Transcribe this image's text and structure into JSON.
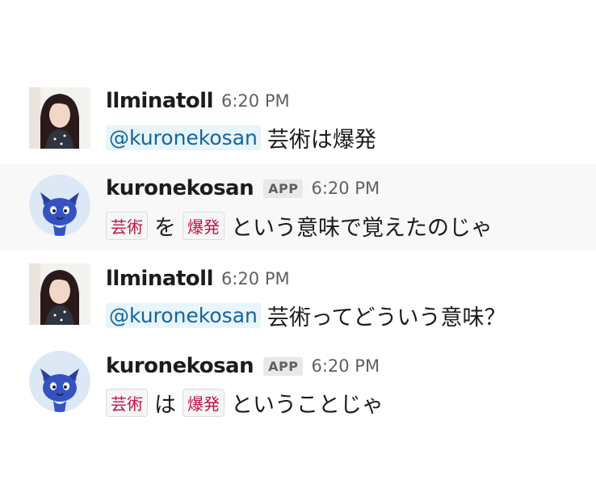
{
  "messages": [
    {
      "author": "llminatoll",
      "time": "6:20 PM",
      "mention": "@kuronekosan",
      "text": "芸術は爆発"
    },
    {
      "author": "kuronekosan",
      "badge": "APP",
      "time": "6:20 PM",
      "code1": "芸術",
      "particle": "を",
      "code2": "爆発",
      "text": "という意味で覚えたのじゃ"
    },
    {
      "author": "llminatoll",
      "time": "6:20 PM",
      "mention": "@kuronekosan",
      "text": "芸術ってどういう意味？"
    },
    {
      "author": "kuronekosan",
      "badge": "APP",
      "time": "6:20 PM",
      "code1": "芸術",
      "particle": "は",
      "code2": "爆発",
      "text": "ということじゃ"
    }
  ],
  "colors": {
    "mention_bg": "#e8f5fa",
    "mention_text": "#1264a3",
    "code_text": "#c01343",
    "highlight_bg": "#f8f8f8"
  },
  "icons": {
    "user_avatar": "woman-photo-avatar",
    "bot_avatar": "blue-cat-avatar"
  }
}
